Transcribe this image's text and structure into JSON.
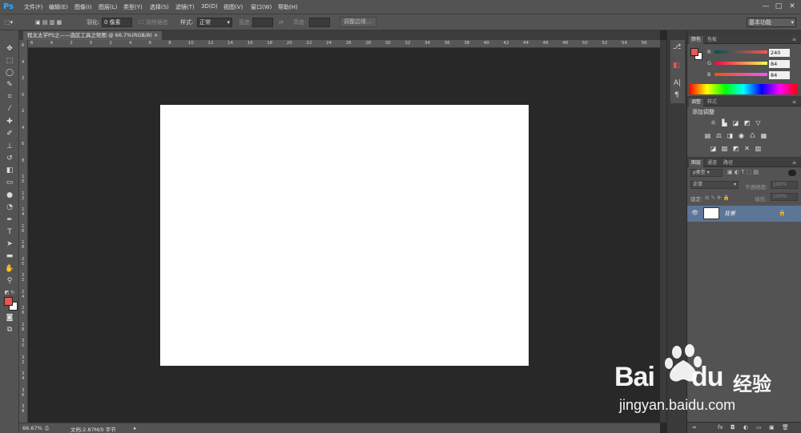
{
  "app": {
    "logo": "Ps",
    "menus": [
      "文件(F)",
      "编辑(E)",
      "图像(I)",
      "图层(L)",
      "类型(Y)",
      "选择(S)",
      "滤镜(T)",
      "3D(D)",
      "视图(V)",
      "窗口(W)",
      "帮助(H)"
    ],
    "window_controls": [
      "—",
      "□",
      "✕"
    ]
  },
  "options": {
    "feather_label": "羽化:",
    "feather_value": "0 像素",
    "antialias_label": "消除锯齿",
    "style_label": "样式:",
    "style_value": "正常",
    "width_label": "宽度:",
    "height_label": "高度:",
    "refine_edge": "调整边缘...",
    "workspace": "基本功能"
  },
  "document": {
    "tab_title": "程太太学PS之——选区工具之矩图 @ 66.7%(RGB/8)",
    "tab_close": "×",
    "canvas_color": "#ffffff"
  },
  "ruler": {
    "h_ticks": [
      "6",
      "4",
      "2",
      "0",
      "2",
      "4",
      "6",
      "8",
      "10",
      "12",
      "14",
      "16",
      "18",
      "20",
      "22",
      "24",
      "26",
      "28",
      "30",
      "32",
      "34",
      "36",
      "38",
      "40",
      "42",
      "44",
      "46",
      "48",
      "50",
      "52",
      "54",
      "56"
    ],
    "v_ticks": [
      "6",
      "4",
      "2",
      "0",
      "2",
      "4",
      "6",
      "8",
      "1 0",
      "1 2",
      "1 4",
      "1 6",
      "1 8",
      "2 0",
      "2 2",
      "2 4",
      "2 6",
      "2 8",
      "3 0",
      "3 2",
      "3 4",
      "3 6",
      "3 8"
    ]
  },
  "status": {
    "zoom": "66.67%",
    "doc_info": "文档:2.87M/0 字节",
    "arrow": "▸"
  },
  "color_panel": {
    "tabs": [
      "颜色",
      "色板"
    ],
    "labels": [
      "R",
      "G",
      "B"
    ],
    "values": [
      "240",
      "84",
      "84"
    ],
    "fg_color": "#f05454",
    "bg_color": "#ffffff"
  },
  "adjust_panel": {
    "tabs": [
      "调整",
      "样式"
    ],
    "title": "添加调整"
  },
  "layers_panel": {
    "tabs": [
      "图层",
      "通道",
      "路径"
    ],
    "filter_label": "ρ类型",
    "blend_mode": "正常",
    "opacity_label": "不透明度:",
    "opacity_value": "100%",
    "lock_label": "锁定:",
    "fill_label": "填充:",
    "fill_value": "100%",
    "layer_name": "背景",
    "bottom_icons": [
      "∞",
      "fx",
      "◘",
      "◐",
      "▭",
      "▣",
      "🗑"
    ]
  },
  "watermark": {
    "brand": "Bai",
    "brand2": "du",
    "cn": "经验",
    "url": "jingyan.baidu.com"
  }
}
